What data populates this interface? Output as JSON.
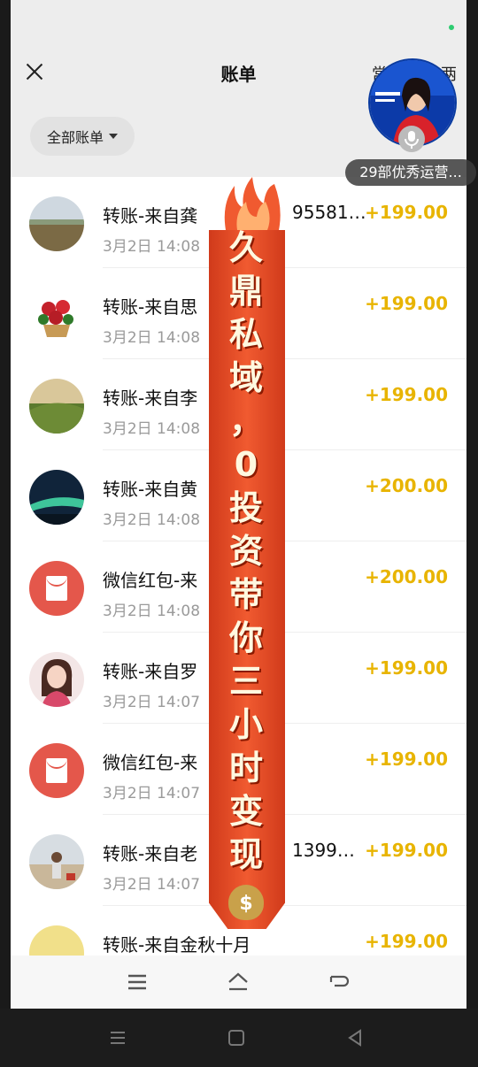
{
  "header": {
    "title": "账单",
    "right_label": "常",
    "right_label2": "两"
  },
  "filter": {
    "label": "全部账单"
  },
  "transactions": [
    {
      "name": "转账-来自龚",
      "name_tail": "95581…",
      "time": "3月2日 14:08",
      "amount": "+199.00",
      "avatar": "landscape-plain"
    },
    {
      "name": "转账-来自思",
      "name_tail": "",
      "time": "3月2日 14:08",
      "amount": "+199.00",
      "avatar": "flower-basket"
    },
    {
      "name": "转账-来自李",
      "name_tail": "",
      "time": "3月2日 14:08",
      "amount": "+199.00",
      "avatar": "sunset-hills"
    },
    {
      "name": "转账-来自黄",
      "name_tail": "",
      "time": "3月2日 14:08",
      "amount": "+200.00",
      "avatar": "night-sky"
    },
    {
      "name": "微信红包-来",
      "name_tail": "",
      "time": "3月2日 14:08",
      "amount": "+200.00",
      "avatar": "red-packet"
    },
    {
      "name": "转账-来自罗",
      "name_tail": "",
      "time": "3月2日 14:07",
      "amount": "+199.00",
      "avatar": "cartoon-girl"
    },
    {
      "name": "微信红包-来",
      "name_tail": "",
      "time": "3月2日 14:07",
      "amount": "+199.00",
      "avatar": "red-packet"
    },
    {
      "name": "转账-来自老",
      "name_tail": "1399…",
      "time": "3月2日 14:07",
      "amount": "+199.00",
      "avatar": "photo-person"
    },
    {
      "name": "转账-来自金秋十月",
      "name_tail": "",
      "time": "",
      "amount": "+199.00",
      "avatar": "yellow"
    }
  ],
  "overlay": {
    "banner_text": [
      "久",
      "鼎",
      "私",
      "域",
      "，",
      "0",
      "投",
      "资",
      "带",
      "你",
      "三",
      "小",
      "时",
      "变",
      "现"
    ],
    "money_symbol": "$",
    "live_label": "29部优秀运营...",
    "colors": {
      "banner": "#e8472a",
      "banner_dark": "#c02a10",
      "amount": "#e8b400"
    }
  },
  "navbar": {
    "icons": [
      "menu-icon",
      "home-icon",
      "back-icon"
    ]
  },
  "system_nav": {
    "icons": [
      "menu-icon",
      "square-icon",
      "triangle-back-icon"
    ]
  }
}
